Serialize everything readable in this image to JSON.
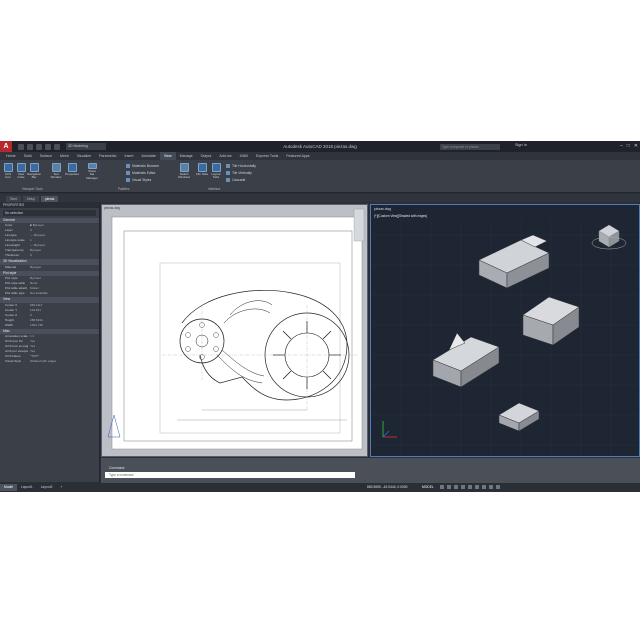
{
  "app_title": "Autodesk AutoCAD 2018   piezas.dwg",
  "app_logo": "A",
  "workspace": "3D Modeling",
  "search_placeholder": "Type a keyword or phrase",
  "signin_label": "Sign In",
  "window_controls": [
    "–",
    "□",
    "✕"
  ],
  "ribbon_tabs": [
    "Home",
    "Solid",
    "Surface",
    "Mesh",
    "Visualize",
    "Parametric",
    "Insert",
    "Annotate",
    "View",
    "Manage",
    "Output",
    "Add-ins",
    "A360",
    "Express Tools",
    "Featured Apps"
  ],
  "ribbon_active_tab": "View",
  "ribbon": {
    "buttons": [
      {
        "label": "UCS Icon",
        "icon": "ucs-icon"
      },
      {
        "label": "View Cube",
        "icon": "viewcube-icon"
      },
      {
        "label": "Navigation Bar",
        "icon": "navbar-icon"
      },
      {
        "label": "Text Window",
        "icon": "text-window-icon"
      },
      {
        "label": "Properties",
        "icon": "properties-icon"
      },
      {
        "label": "Sheet Set Manager",
        "icon": "sheet-set-icon"
      },
      {
        "label": "Switch Windows",
        "icon": "switch-windows-icon"
      },
      {
        "label": "File Tabs",
        "icon": "file-tabs-icon"
      },
      {
        "label": "Layout Tabs",
        "icon": "layout-tabs-icon"
      }
    ],
    "palette_items": [
      "Materials Browser",
      "Materials Editor",
      "Visual Styles"
    ],
    "tile_items": [
      "Tile Horizontally",
      "Tile Vertically",
      "Cascade"
    ],
    "panels": [
      "Viewport Tools",
      "Palettes",
      "Interface"
    ]
  },
  "doc_tabs": [
    "Start",
    "Setup",
    "piezas"
  ],
  "doc_tab_active": "piezas",
  "properties": {
    "header": "PROPERTIES",
    "selection": "No selection",
    "sections": [
      {
        "title": "General",
        "rows": [
          [
            "Color",
            "■ ByLayer"
          ],
          [
            "Layer",
            "0"
          ],
          [
            "Linetype",
            "— ByLayer"
          ],
          [
            "Linetype scale",
            "1"
          ],
          [
            "Lineweight",
            "— ByLayer"
          ],
          [
            "Transparency",
            "ByLayer"
          ],
          [
            "Thickness",
            "0"
          ]
        ]
      },
      {
        "title": "3D Visualization",
        "rows": [
          [
            "Material",
            "ByLayer"
          ]
        ]
      },
      {
        "title": "Plot style",
        "rows": [
          [
            "Plot style",
            "ByColor"
          ],
          [
            "Plot style table",
            "None"
          ],
          [
            "Plot table attach...",
            "Model"
          ],
          [
            "Plot table type",
            "Not available"
          ]
        ]
      },
      {
        "title": "View",
        "rows": [
          [
            "Center X",
            "681.1117"
          ],
          [
            "Center Y",
            "110.631"
          ],
          [
            "Center Z",
            "0"
          ],
          [
            "Height",
            "288.8221"
          ],
          [
            "Width",
            "1401.746"
          ]
        ]
      },
      {
        "title": "Misc",
        "rows": [
          [
            "Annotation scale",
            "1:1"
          ],
          [
            "UCS icon On",
            "Yes"
          ],
          [
            "UCS icon at origin",
            "Yes"
          ],
          [
            "UCS per viewport",
            "Yes"
          ],
          [
            "UCS Name",
            "*TOP*"
          ],
          [
            "Visual Style",
            "Shaded with edges"
          ]
        ]
      }
    ]
  },
  "viewport_left": {
    "label": "piezas.dwg"
  },
  "viewport_right": {
    "label": "piezas.dwg",
    "header": "[+][Custom View][Shaded with edges]"
  },
  "command": {
    "history": "Command:",
    "placeholder": "Type a command"
  },
  "layout_tabs": [
    "Model",
    "Layout1",
    "Layout2",
    "+"
  ],
  "layout_active": "Model",
  "status": {
    "coords": "863.9690, -42.0444, 0.0000",
    "mode": "MODEL"
  },
  "colors": {
    "chrome_dark": "#2b2f38",
    "accent": "#4f7bb8",
    "logo_red": "#b5292c"
  }
}
